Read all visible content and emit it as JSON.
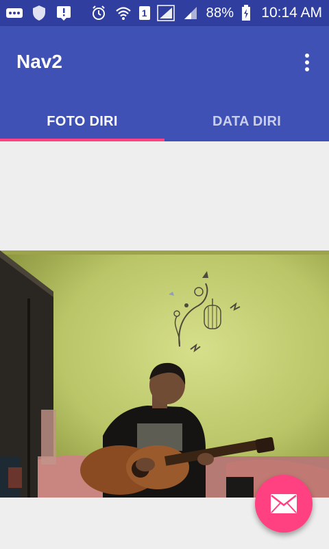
{
  "status_bar": {
    "sim_label": "1",
    "battery_text": "88%",
    "time": "10:14 AM",
    "icons": [
      "more-icon",
      "shield-icon",
      "alert-download-icon",
      "alarm-icon",
      "wifi-icon",
      "sim-icon",
      "signal-icon",
      "signal-icon",
      "battery-charging-icon"
    ]
  },
  "app_bar": {
    "title": "Nav2",
    "overflow_icon": "more-vert-icon",
    "color": "#3f51b5"
  },
  "tabs": [
    {
      "label": "FOTO DIRI",
      "selected": true
    },
    {
      "label": "DATA DIRI",
      "selected": false
    }
  ],
  "colors": {
    "primary": "#3f51b5",
    "primary_dark": "#303f9f",
    "accent": "#ff4081"
  },
  "fab": {
    "icon": "email-icon"
  }
}
